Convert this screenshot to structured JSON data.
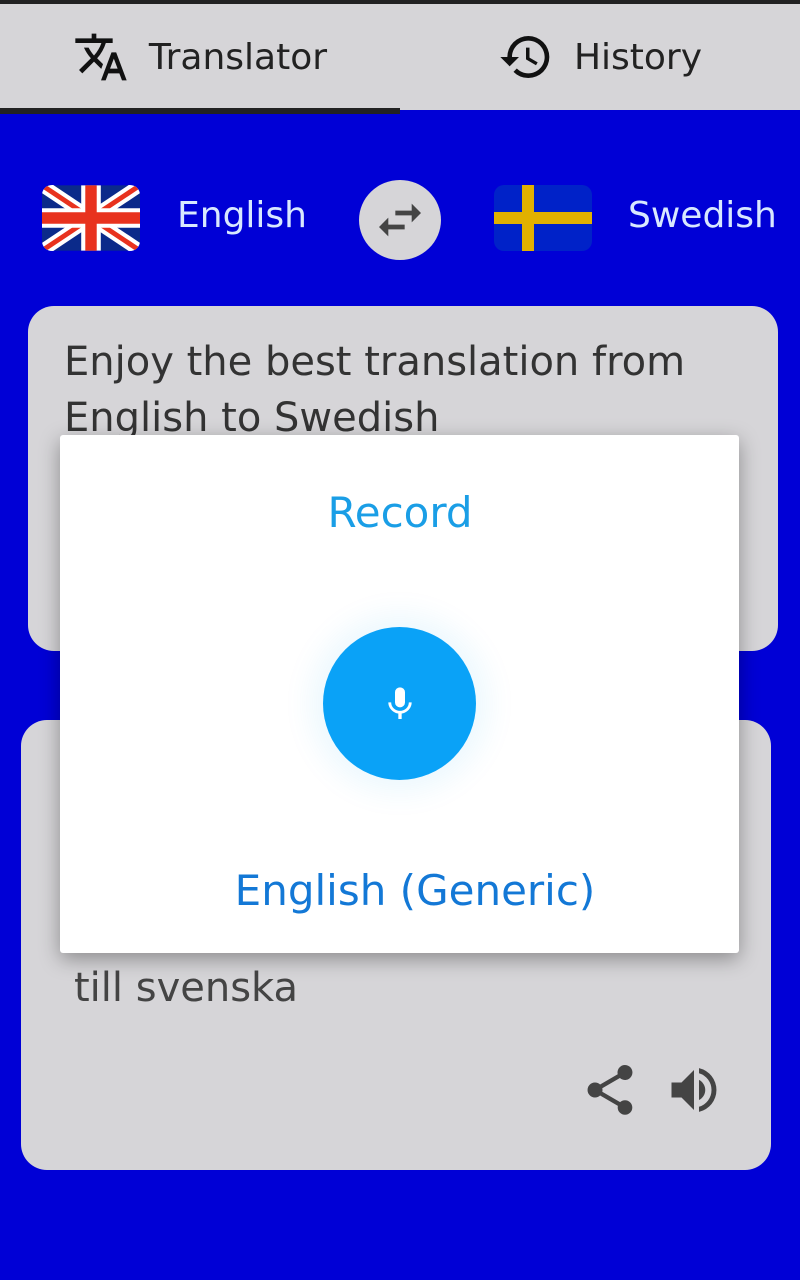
{
  "tabs": [
    {
      "label": "Translator",
      "icon": "translate-icon",
      "active": true
    },
    {
      "label": "History",
      "icon": "history-icon",
      "active": false
    }
  ],
  "languages": {
    "source": "English",
    "target": "Swedish",
    "source_flag": "uk-flag-icon",
    "target_flag": "sweden-flag-icon"
  },
  "source_text": "Enjoy the best translation from English to Swedish",
  "translated_text_visible": "till svenska",
  "dialog": {
    "title": "Record",
    "language": "English (Generic)"
  },
  "colors": {
    "background": "#0000d6",
    "accent": "#0aa2f7",
    "tab_bar": "#d6d5d8"
  }
}
